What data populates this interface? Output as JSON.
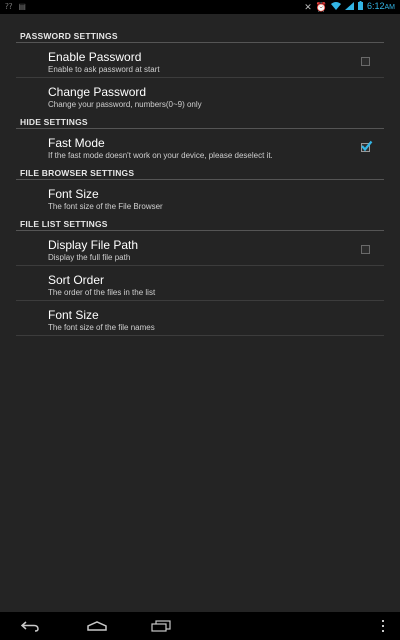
{
  "status_bar": {
    "left_icons": [
      "notification-icon",
      "download-icon"
    ],
    "right_icons": [
      "mute-icon",
      "alarm-icon",
      "wifi-icon",
      "signal-icon",
      "battery-icon"
    ],
    "time": "6:12",
    "ampm": "AM"
  },
  "sections": [
    {
      "title": "PASSWORD SETTINGS",
      "items": [
        {
          "title": "Enable Password",
          "summary": "Enable to ask password at start",
          "checkbox": true,
          "checked": false
        },
        {
          "title": "Change Password",
          "summary": "Change your password, numbers(0~9) only",
          "checkbox": false
        }
      ]
    },
    {
      "title": "HIDE SETTINGS",
      "items": [
        {
          "title": "Fast Mode",
          "summary": "If the fast mode doesn't work on your device, please deselect it.",
          "checkbox": true,
          "checked": true
        }
      ]
    },
    {
      "title": "FILE BROWSER SETTINGS",
      "items": [
        {
          "title": "Font Size",
          "summary": "The font size of the File Browser",
          "checkbox": false
        }
      ]
    },
    {
      "title": "FILE LIST SETTINGS",
      "items": [
        {
          "title": "Display File Path",
          "summary": "Display the full file path",
          "checkbox": true,
          "checked": false
        },
        {
          "title": "Sort Order",
          "summary": "The order of the files in the list",
          "checkbox": false
        },
        {
          "title": "Font Size",
          "summary": "The font size of the file names",
          "checkbox": false
        }
      ]
    }
  ],
  "nav_bar": {
    "buttons": [
      "back-icon",
      "home-icon",
      "recent-apps-icon",
      "menu-overflow-icon"
    ]
  },
  "colors": {
    "background": "#242424",
    "accent": "#33b5e5",
    "status_bar": "#000000"
  }
}
